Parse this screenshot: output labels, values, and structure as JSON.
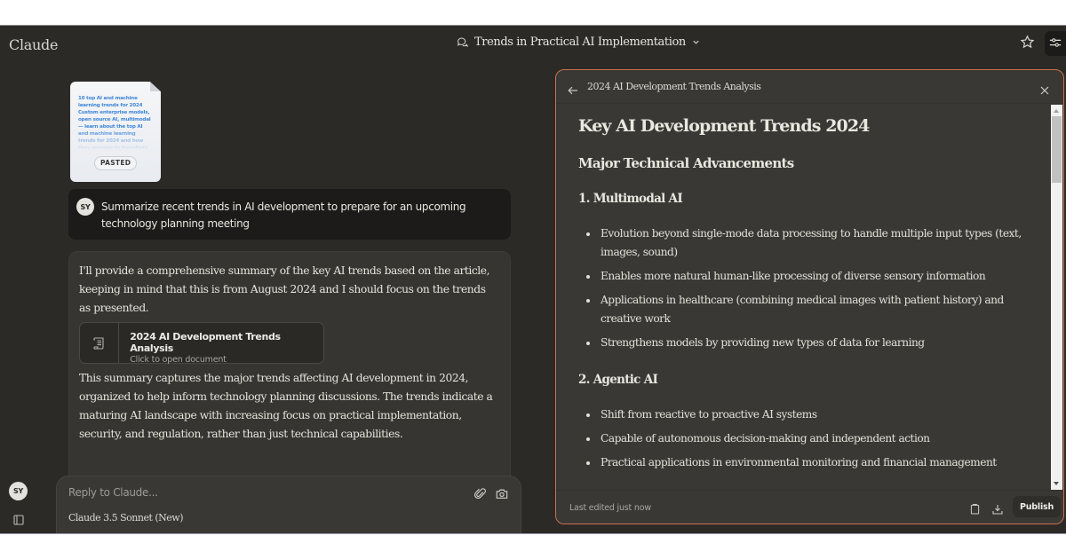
{
  "app": {
    "brand": "Claude",
    "conversation_title": "Trends in Practical AI Implementation",
    "accent_color": "#c7714f"
  },
  "chat": {
    "pasted": {
      "snippet": "10 top AI and machine learning trends for 2024 Custom enterprise models, open source AI, multimodal — learn about the top AI and machine learning trends for 2024 and how they promise to transform",
      "badge": "PASTED"
    },
    "user_message": {
      "avatar": "SY",
      "text": "Summarize recent trends in AI development to prepare for an upcoming technology planning meeting"
    },
    "assistant_message": {
      "intro": "I'll provide a comprehensive summary of the key AI trends based on the article, keeping in mind that this is from August 2024 and I should focus on the trends as presented.",
      "artifact": {
        "title": "2024 AI Development Trends Analysis",
        "subtitle": "Click to open document"
      },
      "outro": "This summary captures the major trends affecting AI development in 2024, organized to help inform technology planning discussions. The trends indicate a maturing AI landscape with increasing focus on practical implementation, security, and regulation, rather than just technical capabilities."
    },
    "sidebar_avatar": "SY",
    "composer": {
      "placeholder": "Reply to Claude...",
      "model": "Claude 3.5 Sonnet (New)"
    }
  },
  "artifact_panel": {
    "header_title": "2024 AI Development Trends Analysis",
    "document": {
      "h1": "Key AI Development Trends 2024",
      "h2": "Major Technical Advancements",
      "sections": [
        {
          "heading": "1. Multimodal AI",
          "bullets": [
            "Evolution beyond single-mode data processing to handle multiple input types (text, images, sound)",
            "Enables more natural human-like processing of diverse sensory information",
            "Applications in healthcare (combining medical images with patient history) and creative work",
            "Strengthens models by providing new types of data for learning"
          ]
        },
        {
          "heading": "2. Agentic AI",
          "bullets": [
            "Shift from reactive to proactive AI systems",
            "Capable of autonomous decision-making and independent action",
            "Practical applications in environmental monitoring and financial management"
          ]
        }
      ]
    },
    "footer": {
      "status": "Last edited just now",
      "publish_label": "Publish"
    }
  }
}
